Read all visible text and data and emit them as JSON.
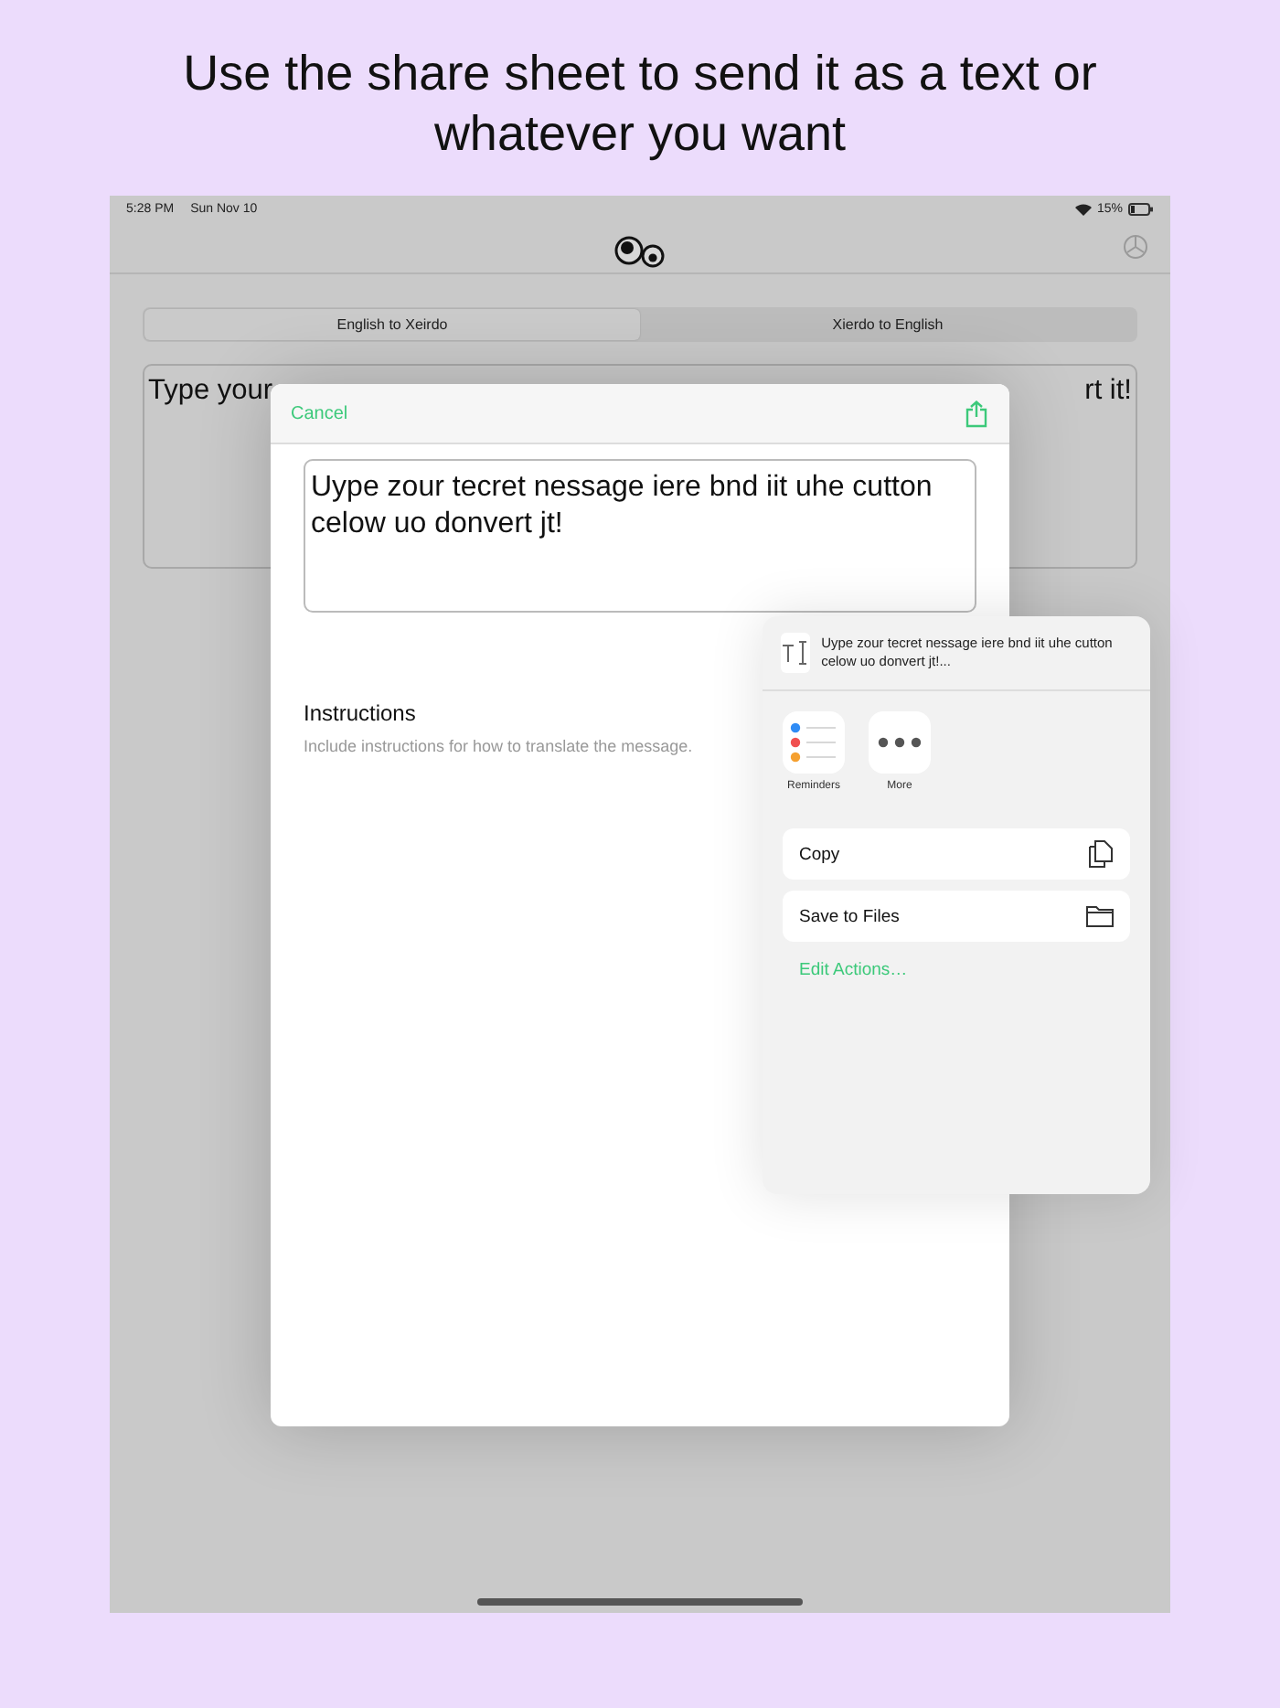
{
  "caption": "Use the share sheet to send it as a text or whatever you want",
  "status_bar": {
    "time": "5:28 PM",
    "date": "Sun Nov 10",
    "battery": "15%"
  },
  "segments": [
    {
      "label": "English to Xeirdo",
      "selected": true
    },
    {
      "label": "Xierdo to English",
      "selected": false
    }
  ],
  "input_visible": [
    "Type your",
    "rt it!"
  ],
  "sheet": {
    "cancel": "Cancel",
    "output": "Uype zour tecret nessage iere bnd iit uhe cutton celow uo donvert jt!",
    "instructions_title": "Instructions",
    "instructions_text": "Include instructions for how to translate the message."
  },
  "share": {
    "preview": "Uype zour tecret nessage iere bnd iit uhe cutton celow uo donvert jt!...",
    "apps": [
      {
        "label": "Reminders",
        "kind": "reminders"
      },
      {
        "label": "More",
        "kind": "more"
      }
    ],
    "actions": [
      {
        "label": "Copy",
        "kind": "copy"
      },
      {
        "label": "Save to Files",
        "kind": "files"
      }
    ],
    "edit": "Edit Actions…"
  }
}
